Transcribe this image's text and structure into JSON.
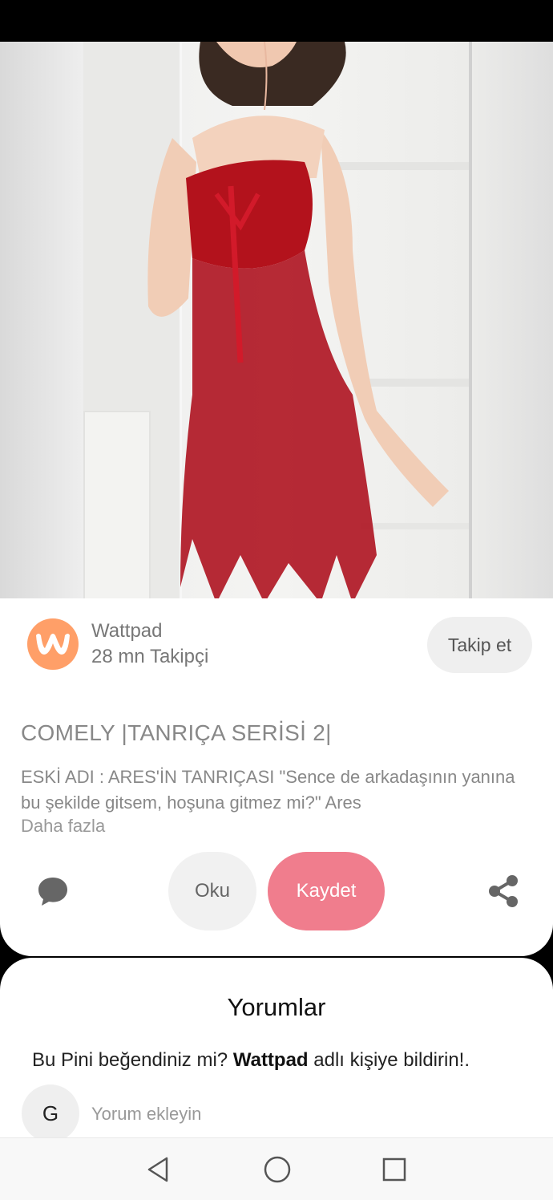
{
  "creator": {
    "name": "Wattpad",
    "followers": "28 mn Takipçi",
    "avatar_icon": "wattpad-logo-icon",
    "avatar_color": "#ff9f68"
  },
  "follow_button_label": "Takip et",
  "pin": {
    "title": "COMELY |TANRIÇA SERİSİ 2|",
    "description": "ESKİ ADI : ARES'İN TANRIÇASI \"Sence de arkadaşının yanına bu şekilde gitsem, hoşuna gitmez mi?\" Ares",
    "more_label": "Daha fazla"
  },
  "actions": {
    "read_label": "Oku",
    "save_label": "Kaydet",
    "save_color": "#f07d8d",
    "comment_icon": "comment-bubble-icon",
    "share_icon": "share-icon"
  },
  "comments": {
    "title": "Yorumlar",
    "prompt_before": "Bu Pini beğendiniz mi? ",
    "prompt_name": "Wattpad",
    "prompt_after": " adlı kişiye bildirin!.",
    "user_initial": "G",
    "input_placeholder": "Yorum ekleyin"
  },
  "nav": {
    "back_icon": "triangle-back-icon",
    "home_icon": "circle-home-icon",
    "recent_icon": "square-recents-icon"
  }
}
